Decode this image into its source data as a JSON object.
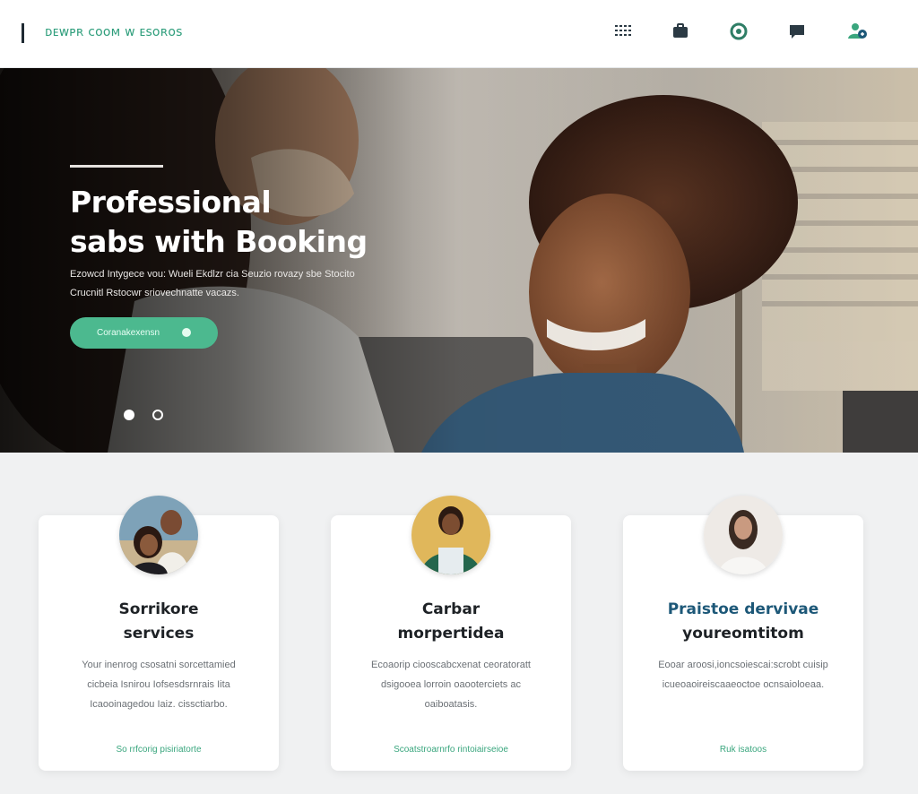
{
  "header": {
    "brand": "ᴅᴇᴡᴘʀ ᴄᴏᴏᴍ ᴡ ᴇsᴏʀᴏs",
    "icons": [
      "grid-menu-icon",
      "briefcase-icon",
      "settings-icon",
      "chat-icon",
      "profile-icon"
    ]
  },
  "hero": {
    "title_line1": "Professional",
    "title_line2": "sabs with Booking",
    "subtitle_line1": "Ezowcd Intygece vou: Wueli Ekdlzr cia Seuzio rovazy sbe Stocito",
    "subtitle_line2": "Crucnitl Rstocwr sriovechnatte vacazs.",
    "cta_label": "Coranakexensn",
    "slides": 2,
    "active_slide": 1
  },
  "cards": [
    {
      "title_line1": "Sorrikore",
      "title_line2": "services",
      "description": "Your inenrog csosatni sorcettamied cicbeia Isnirou Iofsesdsrnrais Iita Icaooinagedou Iaiz. cissctiarbo.",
      "link": "So rrfcorig pisiriatorte"
    },
    {
      "title_line1": "Carbar",
      "title_line2": "morpertidea",
      "description": "Ecoaorip ciooscabcxenat ceoratoratt dsigooea lorroin oaooterciets ac oaiboatasis.",
      "link": "Scoatstroarnrfo rintoiairseioe"
    },
    {
      "title_line1": "Praistoe dervivae",
      "title_line2": "youreomtitom",
      "description": "Eooar aroosi,ioncsoiescai:scrobt cuisip icueoaoireiscaaeoctoe ocnsaioloeaa.",
      "link": "Ruk isatoos"
    }
  ],
  "colors": {
    "accent": "#4cb98f",
    "title_accent": "#1d5878",
    "text_dark": "#1e2226",
    "page_bg": "#f0f1f2"
  }
}
